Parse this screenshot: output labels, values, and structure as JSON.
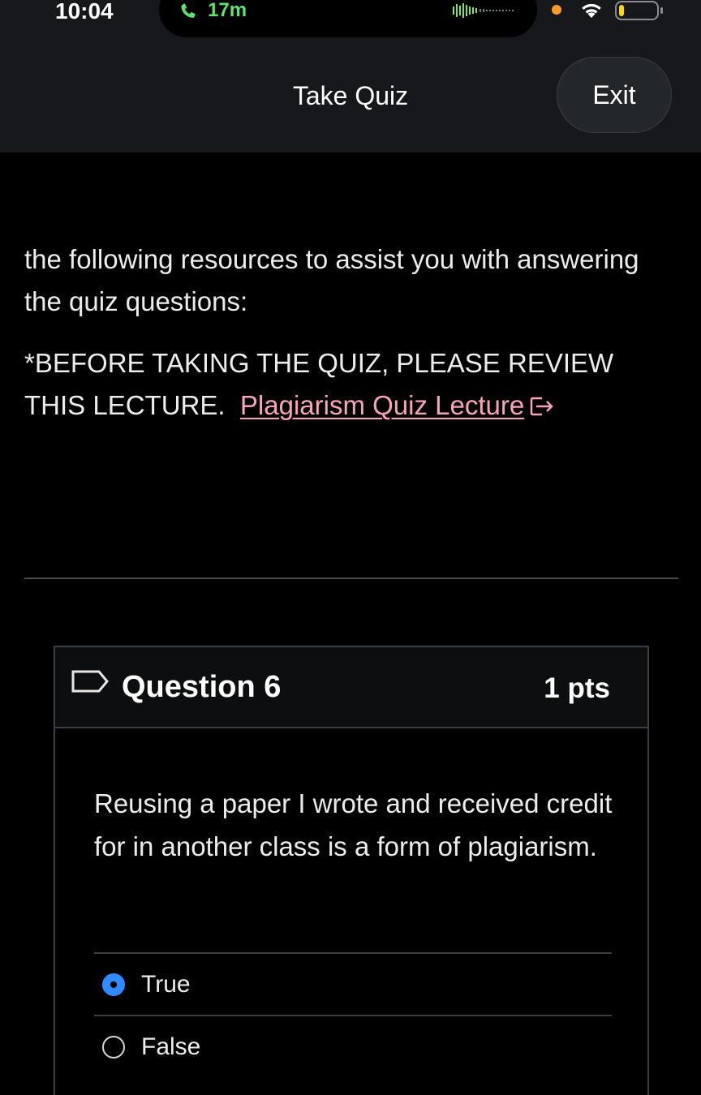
{
  "status_bar": {
    "time": "10:04",
    "call_duration": "17m",
    "icons": [
      "call-icon",
      "waveform-icon",
      "recording-dot",
      "wifi-icon",
      "battery-icon"
    ],
    "call_color": "#5fe16d"
  },
  "header": {
    "title": "Take Quiz",
    "exit_label": "Exit"
  },
  "content": {
    "instructions": "the following resources to assist you with answering the quiz questions:",
    "review_note": "*BEFORE TAKING THE QUIZ, PLEASE REVIEW THIS LECTURE.",
    "link_text": "Plagiarism Quiz Lecture",
    "link_color": "#f7a5b7"
  },
  "question": {
    "title": "Question 6",
    "points": "1 pts",
    "text": "Reusing a paper I wrote and received credit for in another class is a form of plagiarism.",
    "options": [
      {
        "label": "True",
        "selected": true
      },
      {
        "label": "False",
        "selected": false
      }
    ],
    "accent_color": "#2f8bff"
  }
}
